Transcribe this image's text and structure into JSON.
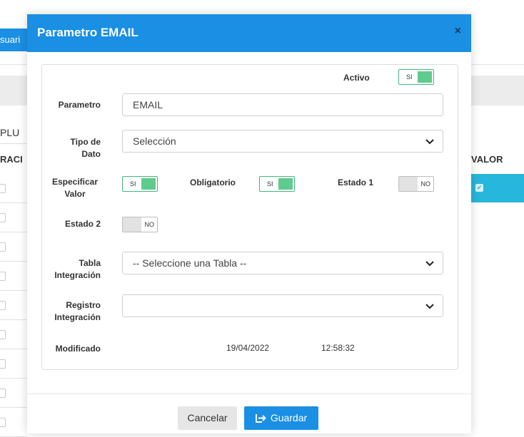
{
  "background": {
    "tab_label": "suari",
    "filter_text": "PLU",
    "table_header_left": "RACI",
    "table_header_right": "VALOR"
  },
  "modal": {
    "title": "Parametro EMAIL",
    "close_symbol": "×",
    "activo": {
      "label": "Activo",
      "state": "SI"
    },
    "parametro": {
      "label": "Parametro",
      "value": "EMAIL"
    },
    "tipo_dato": {
      "label_line1": "Tipo de",
      "label_line2": "Dato",
      "value": "Selección"
    },
    "especificar_valor": {
      "label_line1": "Especificar",
      "label_line2": "Valor",
      "state": "SI"
    },
    "obligatorio": {
      "label": "Obligatorio",
      "state": "SI"
    },
    "estado1": {
      "label": "Estado 1",
      "state": "NO"
    },
    "estado2": {
      "label": "Estado 2",
      "state": "NO"
    },
    "tabla_integracion": {
      "label_line1": "Tabla",
      "label_line2": "Integración",
      "value": "-- Seleccione una Tabla --"
    },
    "registro_integracion": {
      "label_line1": "Registro",
      "label_line2": "Integración",
      "value": ""
    },
    "modificado": {
      "label": "Modificado",
      "date": "19/04/2022",
      "time": "12:58:32"
    },
    "buttons": {
      "cancel": "Cancelar",
      "save": "Guardar"
    }
  },
  "colors": {
    "primary": "#1a8fe3",
    "toggle_on": "#5fcb8e",
    "selected_row": "#27b6dc"
  }
}
